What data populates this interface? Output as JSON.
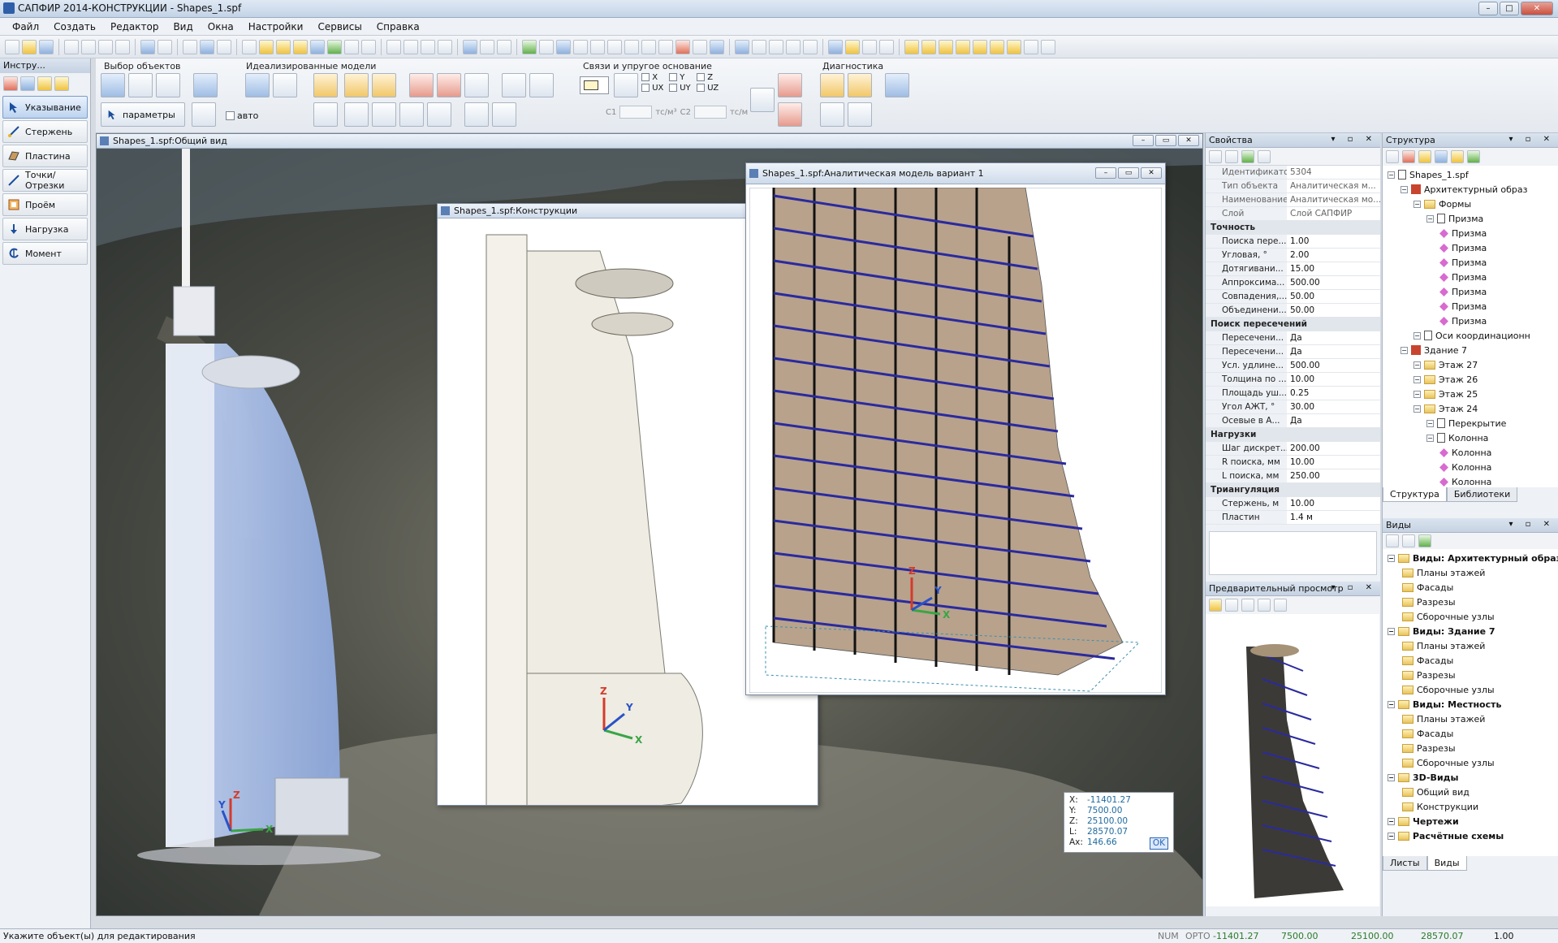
{
  "window": {
    "title": "САПФИР 2014-КОНСТРУКЦИИ - Shapes_1.spf"
  },
  "menu": [
    "Файл",
    "Создать",
    "Редактор",
    "Вид",
    "Окна",
    "Настройки",
    "Сервисы",
    "Справка"
  ],
  "ribbon": {
    "groups": [
      "Выбор объектов",
      "Идеализированные модели",
      "Связи и упругое основание",
      "Диагностика"
    ],
    "params_label": "параметры",
    "auto_label": "авто",
    "constraints": [
      "X",
      "Y",
      "Z",
      "UX",
      "UY",
      "UZ"
    ],
    "c1_label": "C1",
    "c1_unit": "тс/м³",
    "c2_label": "C2",
    "c2_unit": "тс/м"
  },
  "left_panel": {
    "title": "Инстру...",
    "tools": [
      {
        "label": "Указывание",
        "icon": "pointer-icon"
      },
      {
        "label": "Стержень",
        "icon": "rod-icon"
      },
      {
        "label": "Пластина",
        "icon": "plate-icon"
      },
      {
        "label": "Точки/Отрезки",
        "icon": "points-segments-icon"
      },
      {
        "label": "Проём",
        "icon": "opening-icon"
      },
      {
        "label": "Нагрузка",
        "icon": "load-icon"
      },
      {
        "label": "Момент",
        "icon": "moment-icon"
      }
    ]
  },
  "views": {
    "main": "Shapes_1.spf:Общий вид",
    "constructions": "Shapes_1.spf:Конструкции",
    "analytical": "Shapes_1.spf:Аналитическая модель вариант 1"
  },
  "coords": {
    "X": "-11401.27",
    "Y": "7500.00",
    "Z": "25100.00",
    "L": "28570.07",
    "Ax": "146.66",
    "ok": "OK"
  },
  "properties": {
    "title": "Свойства",
    "top_rows": [
      {
        "k": "Идентификатор",
        "v": "5304"
      },
      {
        "k": "Тип объекта",
        "v": "Аналитическая м..."
      },
      {
        "k": "Наименование",
        "v": "Аналитическая мо..."
      },
      {
        "k": "Слой",
        "v": "Слой САПФИР"
      }
    ],
    "sections": [
      {
        "name": "Точность",
        "rows": [
          {
            "k": "Поиска пере...",
            "v": "1.00"
          },
          {
            "k": "Угловая, °",
            "v": "2.00"
          },
          {
            "k": "Дотягивани...",
            "v": "15.00"
          },
          {
            "k": "Аппроксима...",
            "v": "500.00"
          },
          {
            "k": "Совпадения,...",
            "v": "50.00"
          },
          {
            "k": "Объединени...",
            "v": "50.00"
          }
        ]
      },
      {
        "name": "Поиск пересечений",
        "rows": [
          {
            "k": "Пересечени...",
            "v": "Да"
          },
          {
            "k": "Пересечени...",
            "v": "Да"
          },
          {
            "k": "Усл. удлине...",
            "v": "500.00"
          },
          {
            "k": "Толщина по ...",
            "v": "10.00"
          },
          {
            "k": "Площадь уш...",
            "v": "0.25"
          },
          {
            "k": "Угол АЖТ, °",
            "v": "30.00"
          },
          {
            "k": "Осевые в А...",
            "v": "Да"
          }
        ]
      },
      {
        "name": "Нагрузки",
        "rows": [
          {
            "k": "Шаг дискрет...",
            "v": "200.00"
          },
          {
            "k": "R поиска, мм",
            "v": "10.00"
          },
          {
            "k": "L поиска, мм",
            "v": "250.00"
          }
        ]
      },
      {
        "name": "Триангуляция",
        "rows": [
          {
            "k": "Стержень, м",
            "v": "10.00"
          },
          {
            "k": "Пластин",
            "v": "1.4 м"
          }
        ]
      }
    ]
  },
  "preview": {
    "title": "Предварительный просмотр"
  },
  "structure": {
    "title": "Структура",
    "nodes": [
      {
        "label": "Shapes_1.spf",
        "level": 0,
        "icon": "file"
      },
      {
        "label": "Архитектурный образ",
        "level": 1,
        "icon": "bld"
      },
      {
        "label": "Формы",
        "level": 2,
        "icon": "fold"
      },
      {
        "label": "Призма",
        "level": 3,
        "icon": "slab"
      },
      {
        "label": "Призма",
        "level": 4,
        "icon": "prism"
      },
      {
        "label": "Призма",
        "level": 4,
        "icon": "prism"
      },
      {
        "label": "Призма",
        "level": 4,
        "icon": "prism"
      },
      {
        "label": "Призма",
        "level": 4,
        "icon": "prism"
      },
      {
        "label": "Призма",
        "level": 4,
        "icon": "prism"
      },
      {
        "label": "Призма",
        "level": 4,
        "icon": "prism"
      },
      {
        "label": "Призма",
        "level": 4,
        "icon": "prism"
      },
      {
        "label": "Оси координационн",
        "level": 2,
        "icon": "slab"
      },
      {
        "label": "Здание 7",
        "level": 1,
        "icon": "bld"
      },
      {
        "label": "Этаж 27",
        "level": 2,
        "icon": "fold"
      },
      {
        "label": "Этаж 26",
        "level": 2,
        "icon": "fold"
      },
      {
        "label": "Этаж 25",
        "level": 2,
        "icon": "fold"
      },
      {
        "label": "Этаж 24",
        "level": 2,
        "icon": "fold"
      },
      {
        "label": "Перекрытие",
        "level": 3,
        "icon": "slab"
      },
      {
        "label": "Колонна",
        "level": 3,
        "icon": "slab"
      },
      {
        "label": "Колонна",
        "level": 4,
        "icon": "prism"
      },
      {
        "label": "Колонна",
        "level": 4,
        "icon": "prism"
      },
      {
        "label": "Колонна",
        "level": 4,
        "icon": "prism"
      }
    ],
    "tabs": [
      "Структура",
      "Библиотеки"
    ]
  },
  "views_panel": {
    "title": "Виды",
    "nodes": [
      {
        "label": "Виды: Архитектурный образ",
        "level": 0,
        "bold": true
      },
      {
        "label": "Планы этажей",
        "level": 1
      },
      {
        "label": "Фасады",
        "level": 1
      },
      {
        "label": "Разрезы",
        "level": 1
      },
      {
        "label": "Сборочные узлы",
        "level": 1
      },
      {
        "label": "Виды: Здание 7",
        "level": 0,
        "bold": true
      },
      {
        "label": "Планы этажей",
        "level": 1
      },
      {
        "label": "Фасады",
        "level": 1
      },
      {
        "label": "Разрезы",
        "level": 1
      },
      {
        "label": "Сборочные узлы",
        "level": 1
      },
      {
        "label": "Виды: Местность",
        "level": 0,
        "bold": true
      },
      {
        "label": "Планы этажей",
        "level": 1
      },
      {
        "label": "Фасады",
        "level": 1
      },
      {
        "label": "Разрезы",
        "level": 1
      },
      {
        "label": "Сборочные узлы",
        "level": 1
      },
      {
        "label": "3D-Виды",
        "level": 0,
        "bold": true
      },
      {
        "label": "Общий вид",
        "level": 1
      },
      {
        "label": "Конструкции",
        "level": 1
      },
      {
        "label": "Чертежи",
        "level": 0,
        "bold": true
      },
      {
        "label": "Расчётные схемы",
        "level": 0,
        "bold": true
      }
    ],
    "tabs": [
      "Листы",
      "Виды"
    ]
  },
  "status": {
    "message": "Укажите объект(ы) для редактирования",
    "num": "NUM",
    "orto": "ОРТО",
    "x": "-11401.27",
    "y": "7500.00",
    "z": "25100.00",
    "l": "28570.07",
    "scale": "1.00"
  }
}
